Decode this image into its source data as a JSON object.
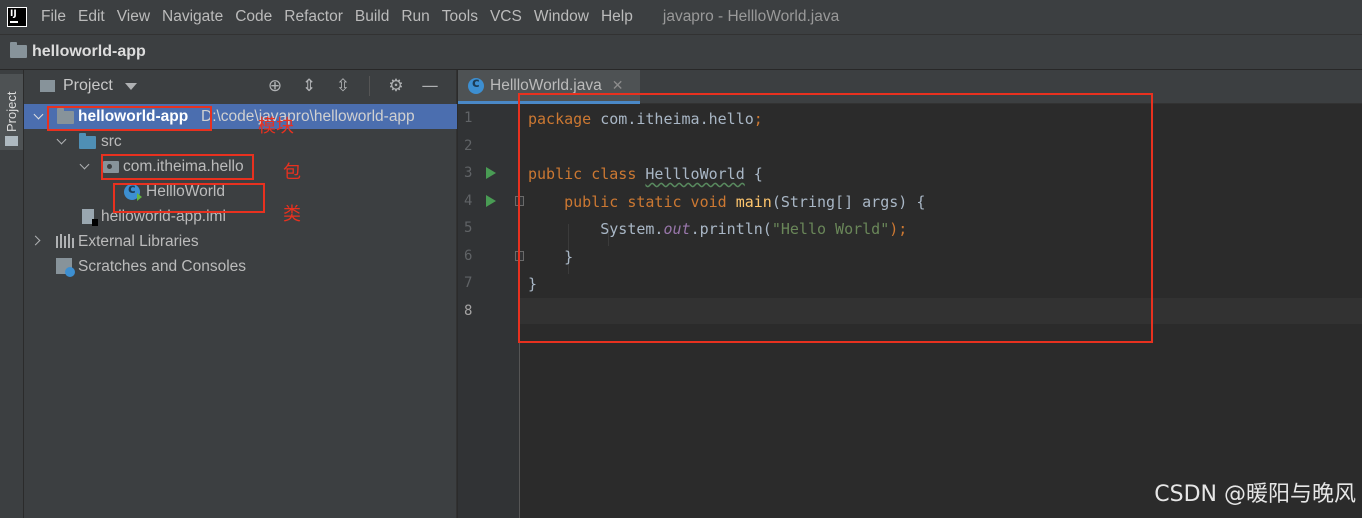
{
  "menubar": {
    "items": [
      "File",
      "Edit",
      "View",
      "Navigate",
      "Code",
      "Refactor",
      "Build",
      "Run",
      "Tools",
      "VCS",
      "Window",
      "Help"
    ],
    "window_title": "javapro - HellloWorld.java"
  },
  "navbar": {
    "project": "helloworld-app"
  },
  "toolstrip": {
    "project_tab": "Project"
  },
  "project_panel": {
    "title": "Project",
    "tree": {
      "root_name": "helloworld-app",
      "root_path": "D:\\code\\javapro\\helloworld-app",
      "src": "src",
      "package": "com.itheima.hello",
      "class": "HellloWorld",
      "iml": "helloworld-app.iml",
      "external_libraries": "External Libraries",
      "scratches": "Scratches and Consoles"
    }
  },
  "annotations": {
    "module": "模块",
    "package": "包",
    "class": "类"
  },
  "editor": {
    "tab_label": "HellloWorld.java",
    "line_numbers": [
      "1",
      "2",
      "3",
      "4",
      "5",
      "6",
      "7",
      "8"
    ],
    "code": {
      "l1_kw": "package",
      "l1_rest": " com.itheima.hello",
      "l1_semi": ";",
      "l3_kw": "public class",
      "l3_name": "HellloWorld",
      "l3_rest": " {",
      "l4_kw": "public static void",
      "l4_fn": "main",
      "l4_rest": "(String[] args) {",
      "l5_a": "System.",
      "l5_field": "out",
      "l5_b": ".println(",
      "l5_str": "\"Hello World\"",
      "l5_c": ");",
      "l6": "}",
      "l7": "}"
    }
  },
  "watermark": "CSDN @暖阳与晚风",
  "colors": {
    "accent_red": "#e8311f",
    "selection": "#4b6eaf",
    "keyword": "#cc7832",
    "string": "#6a8759"
  }
}
